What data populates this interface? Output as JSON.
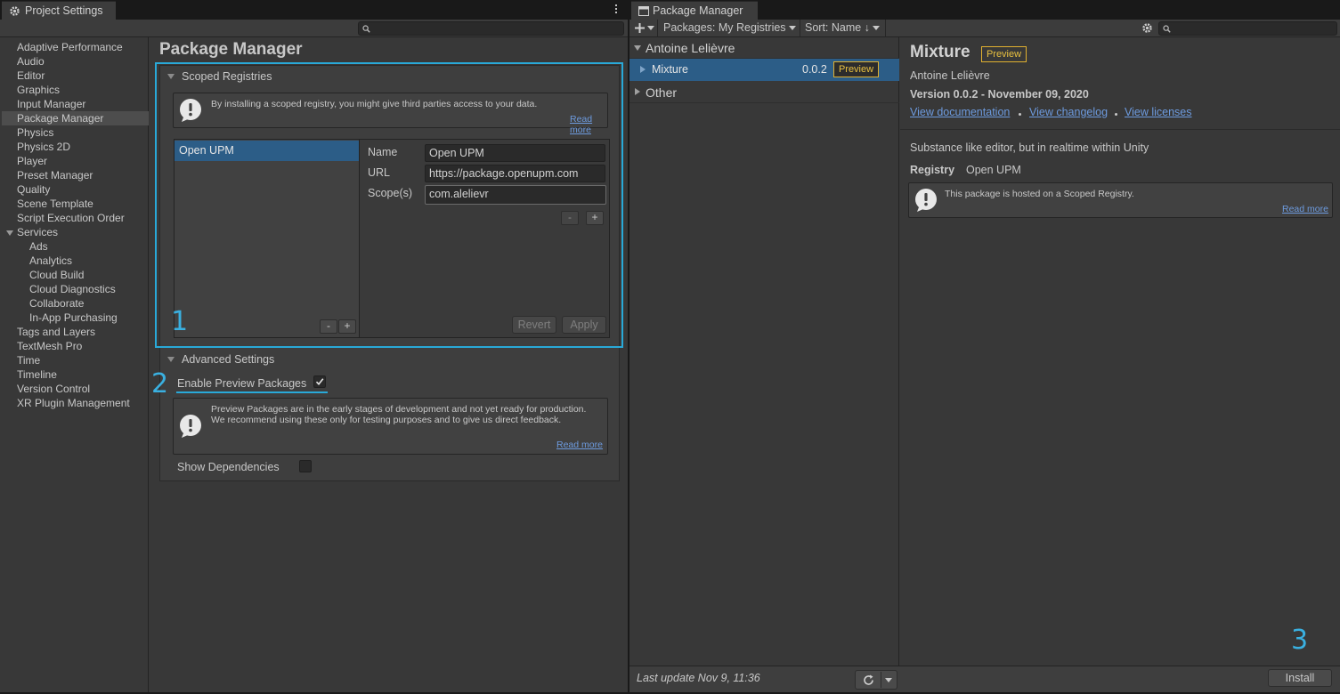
{
  "project_settings": {
    "tab_title": "Project Settings",
    "tab_icon": "gear-icon",
    "search_icon": "search-icon",
    "sidebar": {
      "items": [
        "Adaptive Performance",
        "Audio",
        "Editor",
        "Graphics",
        "Input Manager",
        "Package Manager",
        "Physics",
        "Physics 2D",
        "Player",
        "Preset Manager",
        "Quality",
        "Scene Template",
        "Script Execution Order",
        "Services",
        "Ads",
        "Analytics",
        "Cloud Build",
        "Cloud Diagnostics",
        "Collaborate",
        "In-App Purchasing",
        "Tags and Layers",
        "TextMesh Pro",
        "Time",
        "Timeline",
        "Version Control",
        "XR Plugin Management"
      ],
      "selected": "Package Manager"
    },
    "page_title": "Package Manager",
    "scoped_registries": {
      "header": "Scoped Registries",
      "info": "By installing a scoped registry, you might give third parties access to your data.",
      "read_more": "Read more",
      "registry_list": [
        "Open UPM"
      ],
      "name_label": "Name",
      "name_value": "Open UPM",
      "url_label": "URL",
      "url_value": "https://package.openupm.com",
      "scopes_label": "Scope(s)",
      "scopes_value": "com.alelievr",
      "minus": "-",
      "plus": "+",
      "revert": "Revert",
      "apply": "Apply"
    },
    "advanced_settings": {
      "header": "Advanced Settings",
      "enable_preview_label": "Enable Preview Packages",
      "enable_preview_checked": true,
      "info": "Preview Packages are in the early stages of development and not yet ready for production. We recommend using these only for testing purposes and to give us direct feedback.",
      "read_more": "Read more",
      "show_dependencies_label": "Show Dependencies",
      "show_dependencies_checked": false
    }
  },
  "package_manager": {
    "tab_title": "Package Manager",
    "tab_icon": "package-icon",
    "toolbar": {
      "add_icon": "plus-icon",
      "packages_dropdown": "Packages: My Registries",
      "sort_dropdown": "Sort: Name ↓",
      "settings_icon": "gear-icon",
      "search_icon": "search-icon"
    },
    "groups": [
      {
        "name": "Antoine Lelièvre",
        "expanded": true,
        "packages": [
          {
            "name": "Mixture",
            "version": "0.0.2",
            "tag": "Preview"
          }
        ]
      },
      {
        "name": "Other",
        "expanded": false,
        "packages": []
      }
    ],
    "detail": {
      "title": "Mixture",
      "tag": "Preview",
      "author": "Antoine Lelièvre",
      "version_line": "Version 0.0.2 - November 09, 2020",
      "links": [
        "View documentation",
        "View changelog",
        "View licenses"
      ],
      "description": "Substance like editor, but in realtime within Unity",
      "registry_label": "Registry",
      "registry_value": "Open UPM",
      "info": "This package is hosted on a Scoped Registry.",
      "read_more": "Read more"
    },
    "footer": {
      "last_update": "Last update Nov 9, 11:36",
      "refresh_icon": "refresh-icon",
      "install_button": "Install"
    }
  },
  "annotations": {
    "step1": "1",
    "step2": "2",
    "step3": "3",
    "highlight_color": "#29a9d8"
  }
}
